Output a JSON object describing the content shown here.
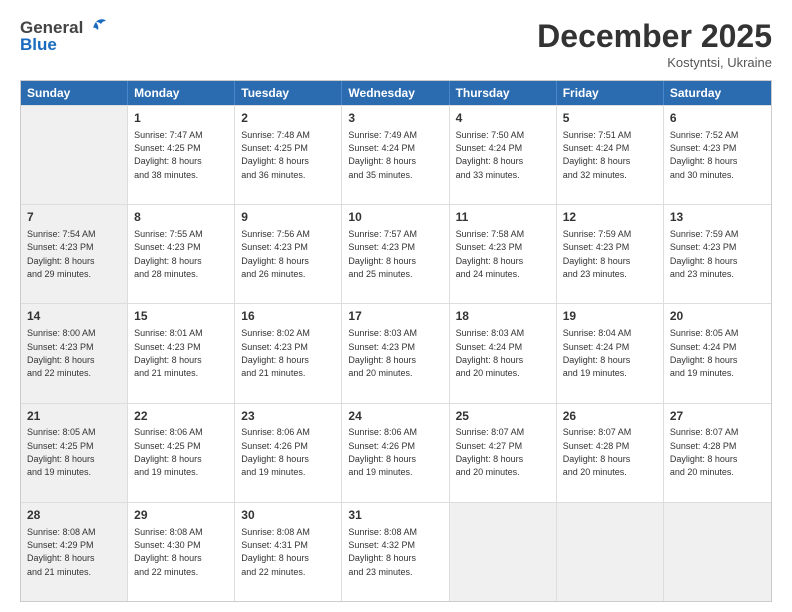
{
  "header": {
    "logo_general": "General",
    "logo_blue": "Blue",
    "month": "December 2025",
    "location": "Kostyntsi, Ukraine"
  },
  "days_of_week": [
    "Sunday",
    "Monday",
    "Tuesday",
    "Wednesday",
    "Thursday",
    "Friday",
    "Saturday"
  ],
  "weeks": [
    [
      {
        "day": "",
        "text": "",
        "shaded": true
      },
      {
        "day": "1",
        "text": "Sunrise: 7:47 AM\nSunset: 4:25 PM\nDaylight: 8 hours\nand 38 minutes.",
        "shaded": false
      },
      {
        "day": "2",
        "text": "Sunrise: 7:48 AM\nSunset: 4:25 PM\nDaylight: 8 hours\nand 36 minutes.",
        "shaded": false
      },
      {
        "day": "3",
        "text": "Sunrise: 7:49 AM\nSunset: 4:24 PM\nDaylight: 8 hours\nand 35 minutes.",
        "shaded": false
      },
      {
        "day": "4",
        "text": "Sunrise: 7:50 AM\nSunset: 4:24 PM\nDaylight: 8 hours\nand 33 minutes.",
        "shaded": false
      },
      {
        "day": "5",
        "text": "Sunrise: 7:51 AM\nSunset: 4:24 PM\nDaylight: 8 hours\nand 32 minutes.",
        "shaded": false
      },
      {
        "day": "6",
        "text": "Sunrise: 7:52 AM\nSunset: 4:23 PM\nDaylight: 8 hours\nand 30 minutes.",
        "shaded": false
      }
    ],
    [
      {
        "day": "7",
        "text": "Sunrise: 7:54 AM\nSunset: 4:23 PM\nDaylight: 8 hours\nand 29 minutes.",
        "shaded": true
      },
      {
        "day": "8",
        "text": "Sunrise: 7:55 AM\nSunset: 4:23 PM\nDaylight: 8 hours\nand 28 minutes.",
        "shaded": false
      },
      {
        "day": "9",
        "text": "Sunrise: 7:56 AM\nSunset: 4:23 PM\nDaylight: 8 hours\nand 26 minutes.",
        "shaded": false
      },
      {
        "day": "10",
        "text": "Sunrise: 7:57 AM\nSunset: 4:23 PM\nDaylight: 8 hours\nand 25 minutes.",
        "shaded": false
      },
      {
        "day": "11",
        "text": "Sunrise: 7:58 AM\nSunset: 4:23 PM\nDaylight: 8 hours\nand 24 minutes.",
        "shaded": false
      },
      {
        "day": "12",
        "text": "Sunrise: 7:59 AM\nSunset: 4:23 PM\nDaylight: 8 hours\nand 23 minutes.",
        "shaded": false
      },
      {
        "day": "13",
        "text": "Sunrise: 7:59 AM\nSunset: 4:23 PM\nDaylight: 8 hours\nand 23 minutes.",
        "shaded": false
      }
    ],
    [
      {
        "day": "14",
        "text": "Sunrise: 8:00 AM\nSunset: 4:23 PM\nDaylight: 8 hours\nand 22 minutes.",
        "shaded": true
      },
      {
        "day": "15",
        "text": "Sunrise: 8:01 AM\nSunset: 4:23 PM\nDaylight: 8 hours\nand 21 minutes.",
        "shaded": false
      },
      {
        "day": "16",
        "text": "Sunrise: 8:02 AM\nSunset: 4:23 PM\nDaylight: 8 hours\nand 21 minutes.",
        "shaded": false
      },
      {
        "day": "17",
        "text": "Sunrise: 8:03 AM\nSunset: 4:23 PM\nDaylight: 8 hours\nand 20 minutes.",
        "shaded": false
      },
      {
        "day": "18",
        "text": "Sunrise: 8:03 AM\nSunset: 4:24 PM\nDaylight: 8 hours\nand 20 minutes.",
        "shaded": false
      },
      {
        "day": "19",
        "text": "Sunrise: 8:04 AM\nSunset: 4:24 PM\nDaylight: 8 hours\nand 19 minutes.",
        "shaded": false
      },
      {
        "day": "20",
        "text": "Sunrise: 8:05 AM\nSunset: 4:24 PM\nDaylight: 8 hours\nand 19 minutes.",
        "shaded": false
      }
    ],
    [
      {
        "day": "21",
        "text": "Sunrise: 8:05 AM\nSunset: 4:25 PM\nDaylight: 8 hours\nand 19 minutes.",
        "shaded": true
      },
      {
        "day": "22",
        "text": "Sunrise: 8:06 AM\nSunset: 4:25 PM\nDaylight: 8 hours\nand 19 minutes.",
        "shaded": false
      },
      {
        "day": "23",
        "text": "Sunrise: 8:06 AM\nSunset: 4:26 PM\nDaylight: 8 hours\nand 19 minutes.",
        "shaded": false
      },
      {
        "day": "24",
        "text": "Sunrise: 8:06 AM\nSunset: 4:26 PM\nDaylight: 8 hours\nand 19 minutes.",
        "shaded": false
      },
      {
        "day": "25",
        "text": "Sunrise: 8:07 AM\nSunset: 4:27 PM\nDaylight: 8 hours\nand 20 minutes.",
        "shaded": false
      },
      {
        "day": "26",
        "text": "Sunrise: 8:07 AM\nSunset: 4:28 PM\nDaylight: 8 hours\nand 20 minutes.",
        "shaded": false
      },
      {
        "day": "27",
        "text": "Sunrise: 8:07 AM\nSunset: 4:28 PM\nDaylight: 8 hours\nand 20 minutes.",
        "shaded": false
      }
    ],
    [
      {
        "day": "28",
        "text": "Sunrise: 8:08 AM\nSunset: 4:29 PM\nDaylight: 8 hours\nand 21 minutes.",
        "shaded": true
      },
      {
        "day": "29",
        "text": "Sunrise: 8:08 AM\nSunset: 4:30 PM\nDaylight: 8 hours\nand 22 minutes.",
        "shaded": false
      },
      {
        "day": "30",
        "text": "Sunrise: 8:08 AM\nSunset: 4:31 PM\nDaylight: 8 hours\nand 22 minutes.",
        "shaded": false
      },
      {
        "day": "31",
        "text": "Sunrise: 8:08 AM\nSunset: 4:32 PM\nDaylight: 8 hours\nand 23 minutes.",
        "shaded": false
      },
      {
        "day": "",
        "text": "",
        "shaded": true
      },
      {
        "day": "",
        "text": "",
        "shaded": true
      },
      {
        "day": "",
        "text": "",
        "shaded": true
      }
    ]
  ]
}
